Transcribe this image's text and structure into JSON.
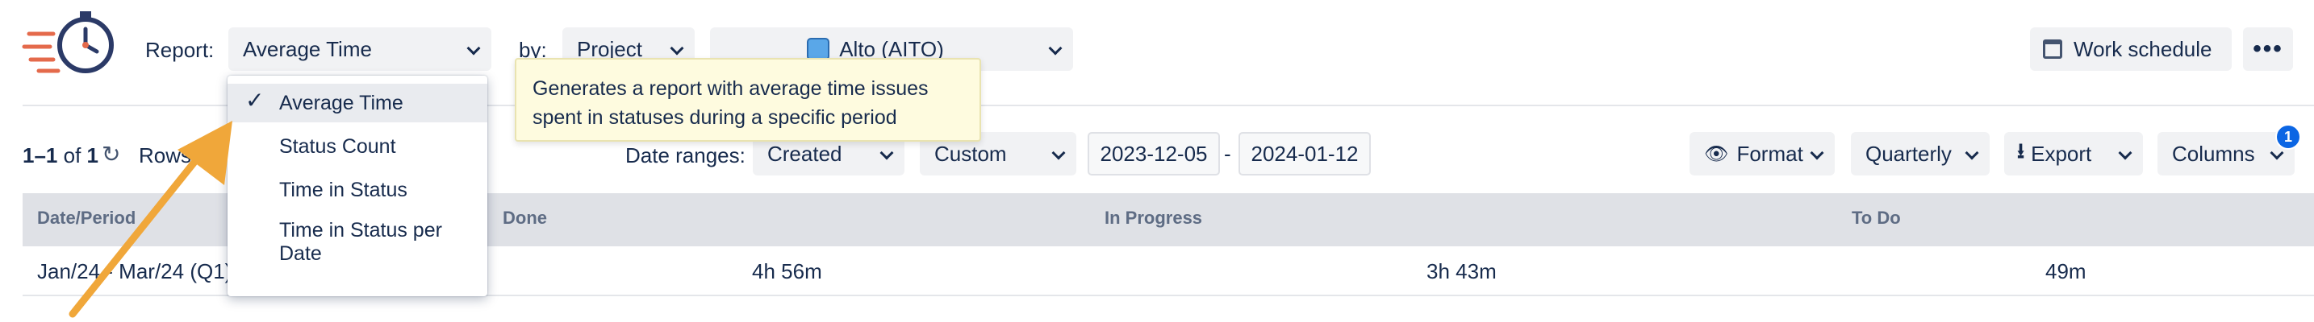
{
  "header": {
    "report_label": "Report:",
    "report_value": "Average Time",
    "by_label": "by:",
    "by_value": "Project",
    "project_value": "Alto (AITO)",
    "work_schedule_label": "Work schedule",
    "more_icon": "more-horizontal-icon"
  },
  "tooltip": {
    "line1": "Generates a report with average time issues",
    "line2": "spent in statuses during a specific period"
  },
  "dropdown": {
    "items": [
      {
        "label": "Average Time",
        "selected": true
      },
      {
        "label": "Status Count",
        "selected": false
      },
      {
        "label": "Time in Status",
        "selected": false
      },
      {
        "label": "Time in Status per Date",
        "selected": false
      }
    ]
  },
  "toolbar": {
    "pagination_range": "1–1",
    "pagination_of": "of",
    "pagination_total": "1",
    "rows_label": "Rows:",
    "date_ranges_label": "Date ranges:",
    "date_field": "Created",
    "date_mode": "Custom",
    "date_from": "2023-12-05",
    "date_separator": "-",
    "date_to": "2024-01-12",
    "format_label": "Format",
    "period_label": "Quarterly",
    "export_label": "Export",
    "columns_label": "Columns",
    "columns_badge": "1"
  },
  "table": {
    "headers": [
      "Date/Period",
      "Done",
      "In Progress",
      "To Do"
    ],
    "rows": [
      {
        "period": "Jan/24 - Mar/24 (Q1)",
        "done": "4h 56m",
        "in_progress": "3h 43m",
        "to_do": "49m"
      }
    ]
  },
  "colors": {
    "accent": "#0c66e4",
    "arrow": "#f0a73a",
    "tooltip_bg": "#fefbdf",
    "header_bg": "#dfe1e6"
  }
}
